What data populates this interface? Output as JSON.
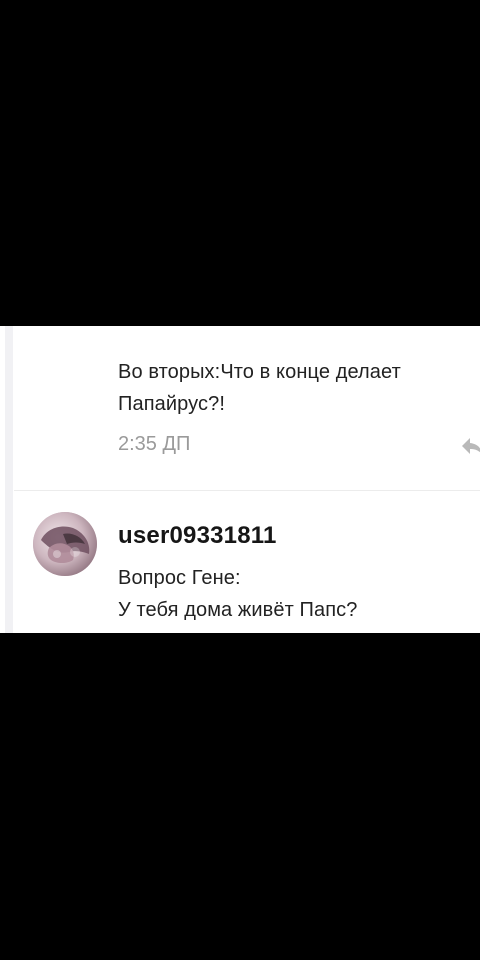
{
  "comments": [
    {
      "text_line1": "Во вторых:Что в конце делает",
      "text_line2": "Папайрус?!",
      "time": "2:35 ДП",
      "reply_icon": "reply-arrow-icon"
    },
    {
      "username": "user09331811",
      "avatar_icon": "user-avatar",
      "text_line1": "Вопрос Гене:",
      "text_line2": "У тебя дома живёт Папс?"
    }
  ],
  "colors": {
    "background": "#000000",
    "panel": "#ffffff",
    "text": "#222222",
    "meta": "#9a9a9a",
    "divider": "#ececec"
  }
}
